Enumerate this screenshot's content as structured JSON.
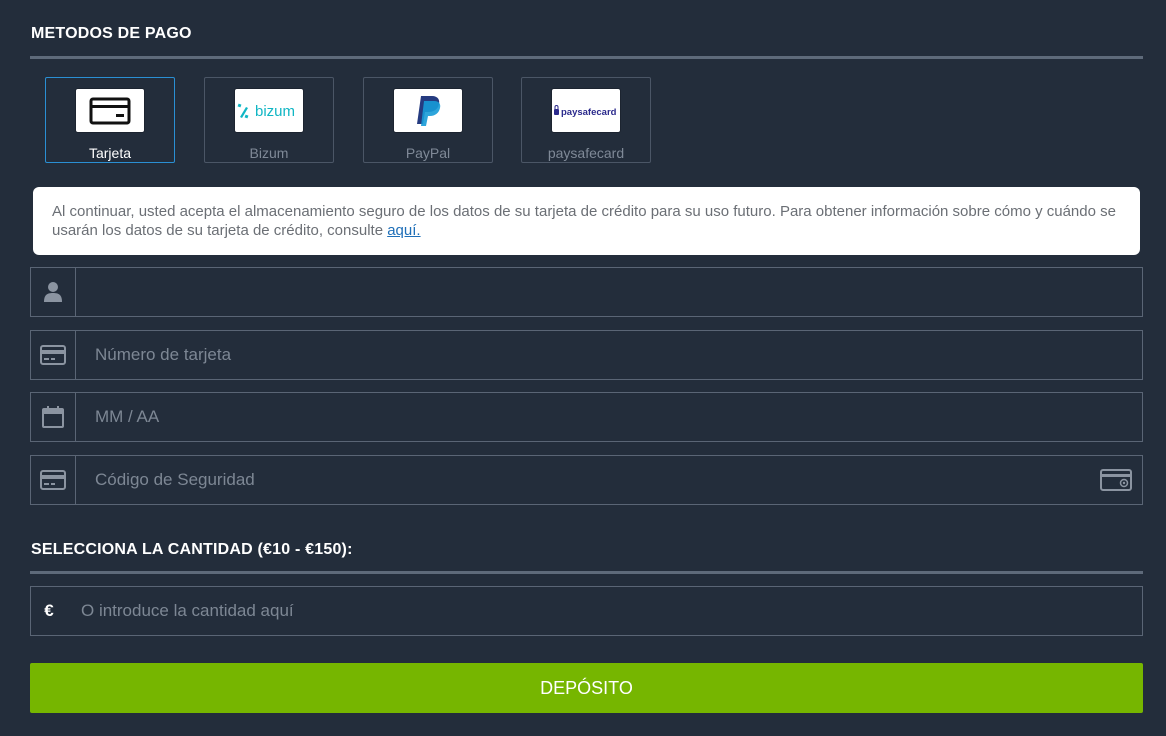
{
  "payment_section": {
    "title": "METODOS DE PAGO"
  },
  "methods": [
    {
      "label": "Tarjeta",
      "logo": "card-icon",
      "selected": true
    },
    {
      "label": "Bizum",
      "logo": "bizum-logo",
      "logo_text": "bizum",
      "selected": false
    },
    {
      "label": "PayPal",
      "logo": "paypal-logo",
      "selected": false
    },
    {
      "label": "paysafecard",
      "logo": "paysafecard-logo",
      "logo_text": "paysafecard",
      "selected": false
    }
  ],
  "notice": {
    "text": "Al continuar, usted acepta el almacenamiento seguro de los datos de su tarjeta de crédito para su uso futuro. Para obtener información sobre cómo y cuándo se usarán los datos de su tarjeta de crédito, consulte ",
    "link": "aquí."
  },
  "fields": {
    "name": {
      "value": "",
      "placeholder": "",
      "icon": "user-icon"
    },
    "card_number": {
      "value": "",
      "placeholder": "Número de tarjeta",
      "icon": "card-icon"
    },
    "expiry": {
      "value": "",
      "placeholder": "MM / AA",
      "icon": "calendar-icon"
    },
    "cvv": {
      "value": "",
      "placeholder": "Código de Seguridad",
      "icon": "card-icon",
      "trailing_icon": "cvv-card-icon"
    }
  },
  "amount_section": {
    "title": "SELECCIONA LA CANTIDAD (€10 - €150):"
  },
  "amount": {
    "currency": "€",
    "value": "",
    "placeholder": "O introduce la cantidad aquí"
  },
  "deposit_button": {
    "label": "DEPÓSITO"
  },
  "colors": {
    "background": "#232d3b",
    "accent_selected": "#2a8fd3",
    "deposit_green": "#76b600",
    "link": "#1f6fb8"
  }
}
